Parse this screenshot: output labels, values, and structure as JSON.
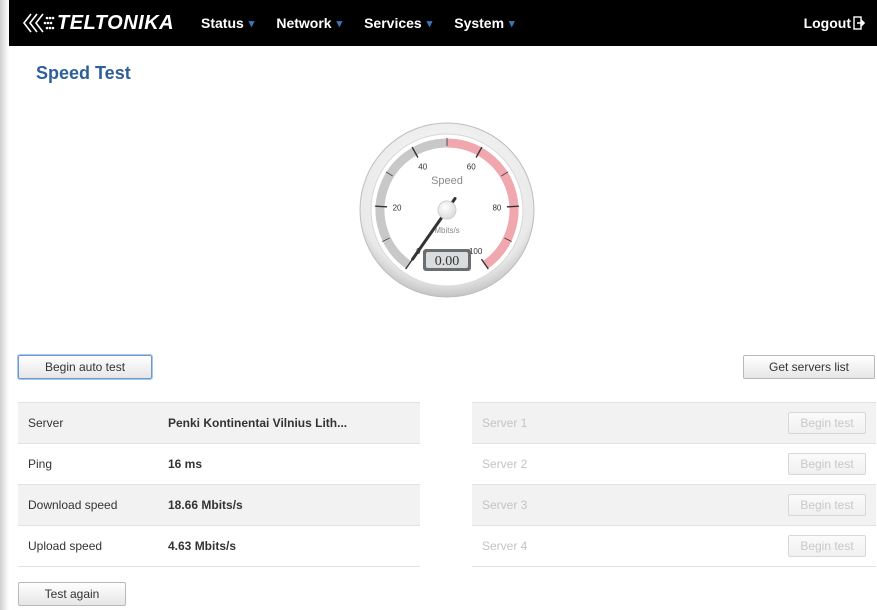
{
  "brand": {
    "logo_text": "TELTONIKA"
  },
  "nav": {
    "items": [
      {
        "label": "Status"
      },
      {
        "label": "Network"
      },
      {
        "label": "Services"
      },
      {
        "label": "System"
      }
    ],
    "logout_label": "Logout"
  },
  "page": {
    "title": "Speed Test"
  },
  "gauge": {
    "title": "Speed",
    "unit": "Mbits/s",
    "readout": "0.00",
    "value": 0,
    "scale_min": 0,
    "scale_max": 100,
    "tick_labels": [
      "0",
      "20",
      "40",
      "60",
      "80",
      "100"
    ],
    "colors": {
      "low_band": "#c8c8c8",
      "high_band": "#f0a7ad",
      "needle": "#333333"
    }
  },
  "buttons": {
    "begin_auto_test": "Begin auto test",
    "get_servers_list": "Get servers list",
    "test_again": "Test again"
  },
  "results": [
    {
      "label": "Server",
      "value": "Penki Kontinentai Vilnius Lith..."
    },
    {
      "label": "Ping",
      "value": "16 ms"
    },
    {
      "label": "Download speed",
      "value": "18.66 Mbits/s"
    },
    {
      "label": "Upload speed",
      "value": "4.63 Mbits/s"
    }
  ],
  "servers": [
    {
      "label": "Server 1",
      "button": "Begin test"
    },
    {
      "label": "Server 2",
      "button": "Begin test"
    },
    {
      "label": "Server 3",
      "button": "Begin test"
    },
    {
      "label": "Server 4",
      "button": "Begin test"
    }
  ],
  "theme": {
    "accent": "#2f5f98",
    "topbar": "#000000",
    "caret": "#3a78b8"
  }
}
